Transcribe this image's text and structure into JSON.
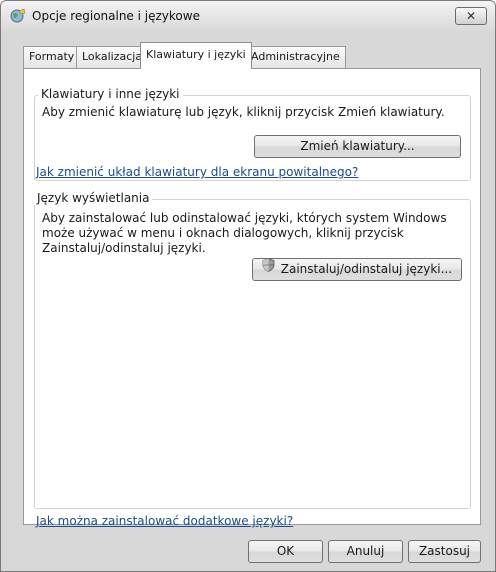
{
  "window": {
    "title": "Opcje regionalne i językowe",
    "close_label": "✕"
  },
  "tabs": [
    {
      "label": "Formaty",
      "active": false
    },
    {
      "label": "Lokalizacja",
      "active": false
    },
    {
      "label": "Klawiatury i języki",
      "active": true
    },
    {
      "label": "Administracyjne",
      "active": false
    }
  ],
  "keyboards_group": {
    "title": "Klawiatury i inne języki",
    "description": "Aby zmienić klawiaturę lub język, kliknij przycisk Zmień klawiatury.",
    "button_label": "Zmień klawiatury...",
    "link": "Jak zmienić układ klawiatury dla ekranu powitalnego?"
  },
  "display_language_group": {
    "title": "Język wyświetlania",
    "description_lines": [
      "Aby zainstalować lub odinstalować języki, których system Windows",
      "może używać w menu i oknach dialogowych, kliknij przycisk",
      "Zainstaluj/odinstaluj języki."
    ],
    "button_label": "Zainstaluj/odinstaluj języki...",
    "button_icon": "uac-shield-icon"
  },
  "bottom_link": "Jak można zainstalować dodatkowe języki?",
  "footer_buttons": {
    "ok": "OK",
    "cancel": "Anuluj",
    "apply": "Zastosuj"
  },
  "colors": {
    "link": "#1c4d8a",
    "dialog_background": "#d8d8d8",
    "panel_background": "#ffffff"
  }
}
